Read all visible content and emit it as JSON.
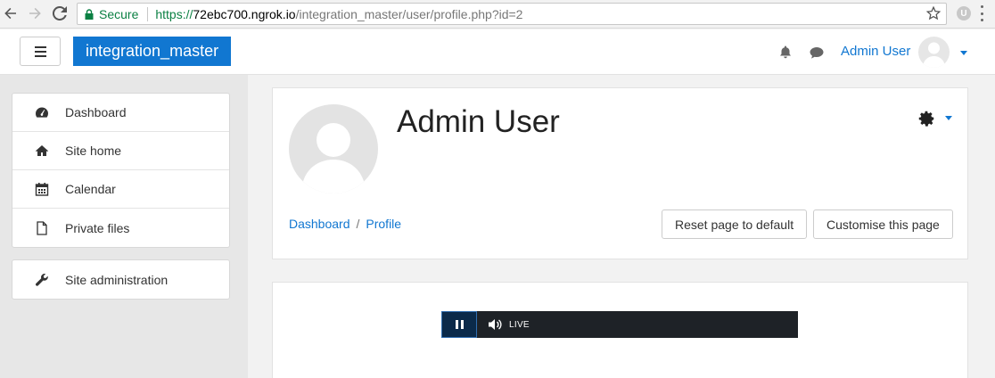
{
  "browser": {
    "secure_label": "Secure",
    "url_scheme": "https://",
    "url_host": "72ebc700.ngrok.io",
    "url_path": "/integration_master/user/profile.php?id=2",
    "extension_letter": "U"
  },
  "navbar": {
    "brand": "integration_master",
    "user_name": "Admin User",
    "brand_color": "#1177d1"
  },
  "sidebar": {
    "items": [
      {
        "label": "Dashboard",
        "icon": "dashboard-icon"
      },
      {
        "label": "Site home",
        "icon": "home-icon"
      },
      {
        "label": "Calendar",
        "icon": "calendar-icon"
      },
      {
        "label": "Private files",
        "icon": "file-icon"
      }
    ],
    "admin": {
      "label": "Site administration",
      "icon": "wrench-icon"
    }
  },
  "header": {
    "title": "Admin User",
    "breadcrumb": [
      "Dashboard",
      "Profile"
    ],
    "breadcrumb_sep": "/",
    "reset_button": "Reset page to default",
    "customise_button": "Customise this page"
  },
  "player": {
    "live_label": "LIVE"
  }
}
